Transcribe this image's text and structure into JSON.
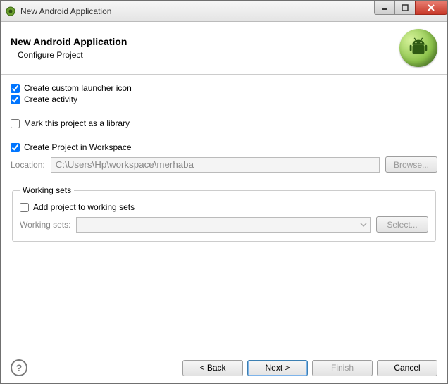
{
  "window": {
    "title": "New Android Application"
  },
  "header": {
    "title": "New Android Application",
    "subtitle": "Configure Project"
  },
  "options": {
    "create_launcher_icon": {
      "label": "Create custom launcher icon",
      "checked": true
    },
    "create_activity": {
      "label": "Create activity",
      "checked": true
    },
    "mark_as_library": {
      "label": "Mark this project as a library",
      "checked": false
    },
    "create_in_workspace": {
      "label": "Create Project in Workspace",
      "checked": true
    }
  },
  "location": {
    "label": "Location:",
    "value": "C:\\Users\\Hp\\workspace\\merhaba",
    "browse": "Browse...",
    "enabled": false
  },
  "working_sets": {
    "legend": "Working sets",
    "add_label": "Add project to working sets",
    "add_checked": false,
    "field_label": "Working sets:",
    "select_label": "Select...",
    "enabled": false
  },
  "footer": {
    "back": "< Back",
    "next": "Next >",
    "finish": "Finish",
    "cancel": "Cancel"
  }
}
